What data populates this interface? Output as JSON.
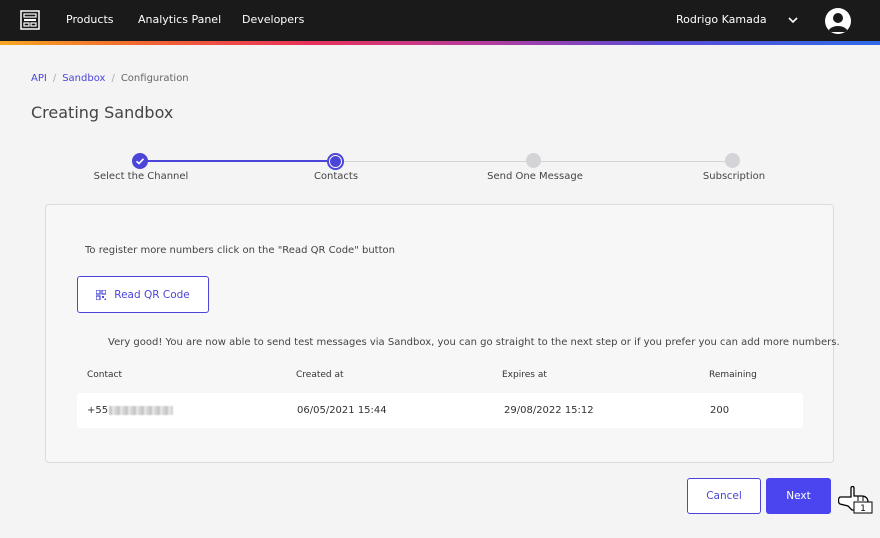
{
  "nav": {
    "items": [
      "Products",
      "Analytics Panel",
      "Developers"
    ],
    "user_name": "Rodrigo Kamada"
  },
  "breadcrumb": [
    "API",
    "Sandbox",
    "Configuration"
  ],
  "page_title": "Creating Sandbox",
  "stepper": {
    "steps": [
      "Select the Channel",
      "Contacts",
      "Send One Message",
      "Subscription"
    ],
    "current_step": 2
  },
  "card": {
    "info_text": "To register more numbers click on the \"Read QR Code\" button",
    "qr_button_label": "Read QR Code",
    "success_text": "Very good! You are now able to send test messages via Sandbox, you can go straight to the next step or if you prefer you can add more numbers.",
    "table": {
      "headers": [
        "Contact",
        "Created at",
        "Expires at",
        "Remaining"
      ],
      "rows": [
        {
          "contact": "+55",
          "created_at": "06/05/2021 15:44",
          "expires_at": "29/08/2022 15:12",
          "remaining": "200"
        }
      ]
    }
  },
  "actions": {
    "cancel_label": "Cancel",
    "next_label": "Next"
  },
  "cursor_badge": "1",
  "colors": {
    "accent": "#4b45d8",
    "topbar": "#1a1a1a",
    "next_button": "#4b45f0"
  }
}
